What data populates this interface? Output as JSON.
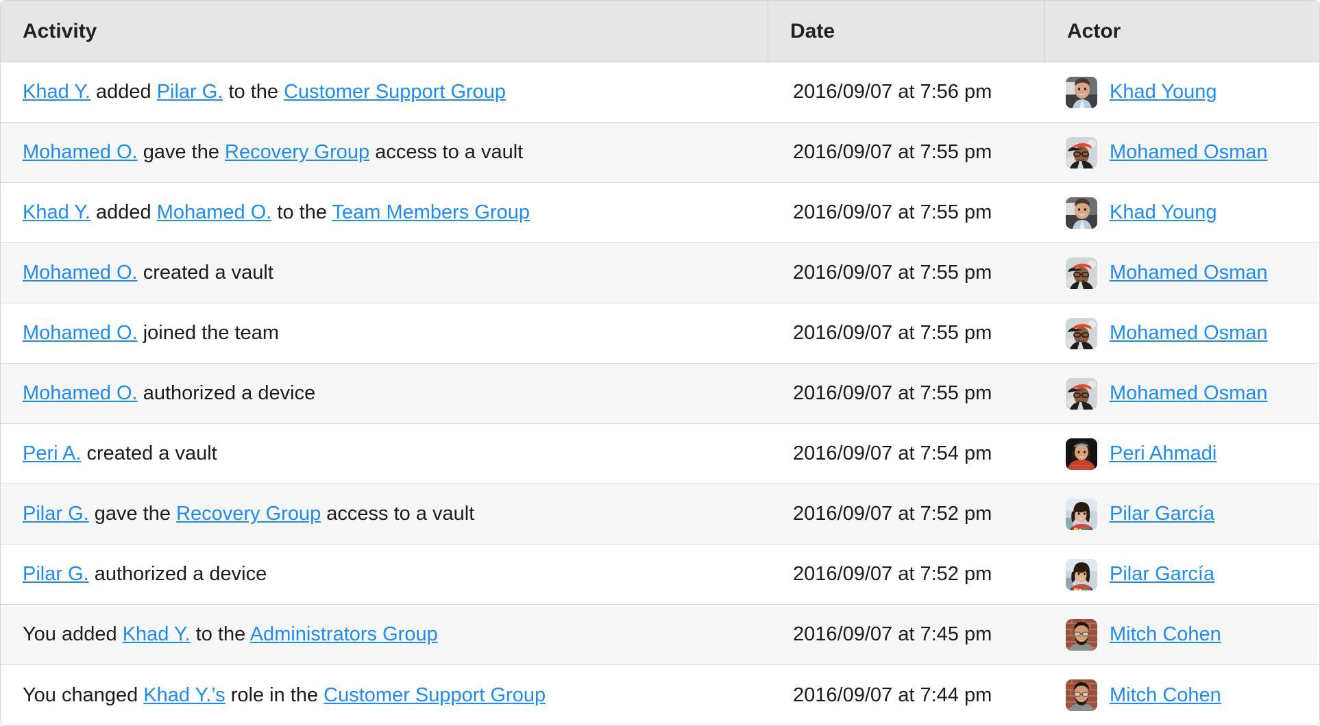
{
  "table": {
    "columns": [
      {
        "key": "activity",
        "label": "Activity"
      },
      {
        "key": "date",
        "label": "Date"
      },
      {
        "key": "actor",
        "label": "Actor"
      }
    ],
    "colors": {
      "link": "#1f8bf5",
      "header_background": "#e6e6e6",
      "row_odd_background": "#ffffff",
      "row_even_background": "#f7f7f7",
      "border": "#d4d4d4",
      "text": "#1c1c1c"
    },
    "rows": [
      {
        "activity_parts": [
          {
            "text": "Khad Y.",
            "link": true
          },
          {
            "text": " added ",
            "link": false
          },
          {
            "text": "Pilar G.",
            "link": true
          },
          {
            "text": " to the ",
            "link": false
          },
          {
            "text": "Customer Support Group",
            "link": true
          }
        ],
        "date": "2016/09/07 at 7:56 pm",
        "actor": "Khad Young",
        "avatar": "khad-young-avatar"
      },
      {
        "activity_parts": [
          {
            "text": "Mohamed O.",
            "link": true
          },
          {
            "text": " gave the ",
            "link": false
          },
          {
            "text": "Recovery Group",
            "link": true
          },
          {
            "text": " access to a vault",
            "link": false
          }
        ],
        "date": "2016/09/07 at 7:55 pm",
        "actor": "Mohamed Osman",
        "avatar": "mohamed-osman-avatar"
      },
      {
        "activity_parts": [
          {
            "text": "Khad Y.",
            "link": true
          },
          {
            "text": " added ",
            "link": false
          },
          {
            "text": "Mohamed O.",
            "link": true
          },
          {
            "text": " to the ",
            "link": false
          },
          {
            "text": "Team Members Group",
            "link": true
          }
        ],
        "date": "2016/09/07 at 7:55 pm",
        "actor": "Khad Young",
        "avatar": "khad-young-avatar"
      },
      {
        "activity_parts": [
          {
            "text": "Mohamed O.",
            "link": true
          },
          {
            "text": " created a vault",
            "link": false
          }
        ],
        "date": "2016/09/07 at 7:55 pm",
        "actor": "Mohamed Osman",
        "avatar": "mohamed-osman-avatar"
      },
      {
        "activity_parts": [
          {
            "text": "Mohamed O.",
            "link": true
          },
          {
            "text": " joined the team",
            "link": false
          }
        ],
        "date": "2016/09/07 at 7:55 pm",
        "actor": "Mohamed Osman",
        "avatar": "mohamed-osman-avatar"
      },
      {
        "activity_parts": [
          {
            "text": "Mohamed O.",
            "link": true
          },
          {
            "text": " authorized a device",
            "link": false
          }
        ],
        "date": "2016/09/07 at 7:55 pm",
        "actor": "Mohamed Osman",
        "avatar": "mohamed-osman-avatar"
      },
      {
        "activity_parts": [
          {
            "text": "Peri A.",
            "link": true
          },
          {
            "text": " created a vault",
            "link": false
          }
        ],
        "date": "2016/09/07 at 7:54 pm",
        "actor": "Peri Ahmadi",
        "avatar": "peri-ahmadi-avatar"
      },
      {
        "activity_parts": [
          {
            "text": "Pilar G.",
            "link": true
          },
          {
            "text": " gave the ",
            "link": false
          },
          {
            "text": "Recovery Group",
            "link": true
          },
          {
            "text": " access to a vault",
            "link": false
          }
        ],
        "date": "2016/09/07 at 7:52 pm",
        "actor": "Pilar García",
        "avatar": "pilar-garcia-avatar"
      },
      {
        "activity_parts": [
          {
            "text": "Pilar G.",
            "link": true
          },
          {
            "text": " authorized a device",
            "link": false
          }
        ],
        "date": "2016/09/07 at 7:52 pm",
        "actor": "Pilar García",
        "avatar": "pilar-garcia-avatar"
      },
      {
        "activity_parts": [
          {
            "text": "You added ",
            "link": false
          },
          {
            "text": "Khad Y.",
            "link": true
          },
          {
            "text": " to the ",
            "link": false
          },
          {
            "text": "Administrators Group",
            "link": true
          }
        ],
        "date": "2016/09/07 at 7:45 pm",
        "actor": "Mitch Cohen",
        "avatar": "mitch-cohen-avatar"
      },
      {
        "activity_parts": [
          {
            "text": "You changed ",
            "link": false
          },
          {
            "text": "Khad Y.’s",
            "link": true
          },
          {
            "text": " role in the ",
            "link": false
          },
          {
            "text": "Customer Support Group",
            "link": true
          }
        ],
        "date": "2016/09/07 at 7:44 pm",
        "actor": "Mitch Cohen",
        "avatar": "mitch-cohen-avatar"
      }
    ]
  }
}
